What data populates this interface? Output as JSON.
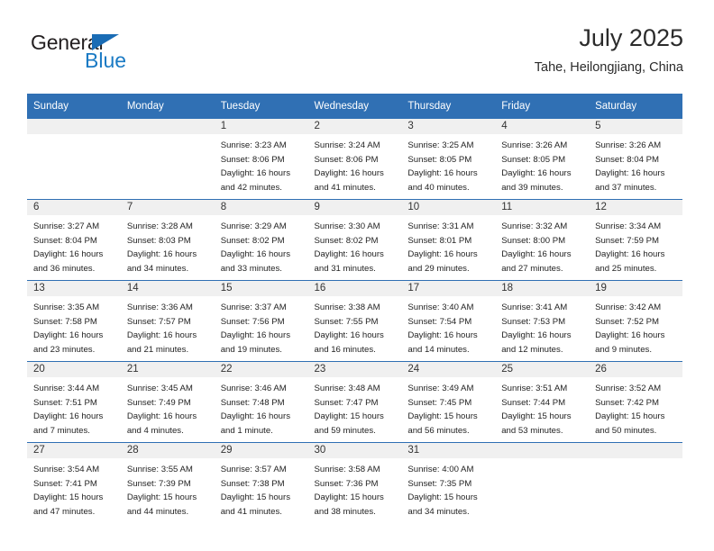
{
  "brand": {
    "name_dark": "General",
    "name_blue": "Blue",
    "triangle_color": "#1a6cb5",
    "blue_text_color": "#1a7ac4"
  },
  "header": {
    "title": "July 2025",
    "location": "Tahe, Heilongjiang, China"
  },
  "theme": {
    "header_blue": "#3070b4",
    "row_divider_blue": "#2f6fb3",
    "daynum_band": "#f0f0f0"
  },
  "weekday_headers": [
    "Sunday",
    "Monday",
    "Tuesday",
    "Wednesday",
    "Thursday",
    "Friday",
    "Saturday"
  ],
  "weeks": [
    [
      {
        "day": "",
        "sunrise": "",
        "sunset": "",
        "daylight_line1": "",
        "daylight_line2": ""
      },
      {
        "day": "",
        "sunrise": "",
        "sunset": "",
        "daylight_line1": "",
        "daylight_line2": ""
      },
      {
        "day": "1",
        "sunrise": "Sunrise: 3:23 AM",
        "sunset": "Sunset: 8:06 PM",
        "daylight_line1": "Daylight: 16 hours",
        "daylight_line2": "and 42 minutes."
      },
      {
        "day": "2",
        "sunrise": "Sunrise: 3:24 AM",
        "sunset": "Sunset: 8:06 PM",
        "daylight_line1": "Daylight: 16 hours",
        "daylight_line2": "and 41 minutes."
      },
      {
        "day": "3",
        "sunrise": "Sunrise: 3:25 AM",
        "sunset": "Sunset: 8:05 PM",
        "daylight_line1": "Daylight: 16 hours",
        "daylight_line2": "and 40 minutes."
      },
      {
        "day": "4",
        "sunrise": "Sunrise: 3:26 AM",
        "sunset": "Sunset: 8:05 PM",
        "daylight_line1": "Daylight: 16 hours",
        "daylight_line2": "and 39 minutes."
      },
      {
        "day": "5",
        "sunrise": "Sunrise: 3:26 AM",
        "sunset": "Sunset: 8:04 PM",
        "daylight_line1": "Daylight: 16 hours",
        "daylight_line2": "and 37 minutes."
      }
    ],
    [
      {
        "day": "6",
        "sunrise": "Sunrise: 3:27 AM",
        "sunset": "Sunset: 8:04 PM",
        "daylight_line1": "Daylight: 16 hours",
        "daylight_line2": "and 36 minutes."
      },
      {
        "day": "7",
        "sunrise": "Sunrise: 3:28 AM",
        "sunset": "Sunset: 8:03 PM",
        "daylight_line1": "Daylight: 16 hours",
        "daylight_line2": "and 34 minutes."
      },
      {
        "day": "8",
        "sunrise": "Sunrise: 3:29 AM",
        "sunset": "Sunset: 8:02 PM",
        "daylight_line1": "Daylight: 16 hours",
        "daylight_line2": "and 33 minutes."
      },
      {
        "day": "9",
        "sunrise": "Sunrise: 3:30 AM",
        "sunset": "Sunset: 8:02 PM",
        "daylight_line1": "Daylight: 16 hours",
        "daylight_line2": "and 31 minutes."
      },
      {
        "day": "10",
        "sunrise": "Sunrise: 3:31 AM",
        "sunset": "Sunset: 8:01 PM",
        "daylight_line1": "Daylight: 16 hours",
        "daylight_line2": "and 29 minutes."
      },
      {
        "day": "11",
        "sunrise": "Sunrise: 3:32 AM",
        "sunset": "Sunset: 8:00 PM",
        "daylight_line1": "Daylight: 16 hours",
        "daylight_line2": "and 27 minutes."
      },
      {
        "day": "12",
        "sunrise": "Sunrise: 3:34 AM",
        "sunset": "Sunset: 7:59 PM",
        "daylight_line1": "Daylight: 16 hours",
        "daylight_line2": "and 25 minutes."
      }
    ],
    [
      {
        "day": "13",
        "sunrise": "Sunrise: 3:35 AM",
        "sunset": "Sunset: 7:58 PM",
        "daylight_line1": "Daylight: 16 hours",
        "daylight_line2": "and 23 minutes."
      },
      {
        "day": "14",
        "sunrise": "Sunrise: 3:36 AM",
        "sunset": "Sunset: 7:57 PM",
        "daylight_line1": "Daylight: 16 hours",
        "daylight_line2": "and 21 minutes."
      },
      {
        "day": "15",
        "sunrise": "Sunrise: 3:37 AM",
        "sunset": "Sunset: 7:56 PM",
        "daylight_line1": "Daylight: 16 hours",
        "daylight_line2": "and 19 minutes."
      },
      {
        "day": "16",
        "sunrise": "Sunrise: 3:38 AM",
        "sunset": "Sunset: 7:55 PM",
        "daylight_line1": "Daylight: 16 hours",
        "daylight_line2": "and 16 minutes."
      },
      {
        "day": "17",
        "sunrise": "Sunrise: 3:40 AM",
        "sunset": "Sunset: 7:54 PM",
        "daylight_line1": "Daylight: 16 hours",
        "daylight_line2": "and 14 minutes."
      },
      {
        "day": "18",
        "sunrise": "Sunrise: 3:41 AM",
        "sunset": "Sunset: 7:53 PM",
        "daylight_line1": "Daylight: 16 hours",
        "daylight_line2": "and 12 minutes."
      },
      {
        "day": "19",
        "sunrise": "Sunrise: 3:42 AM",
        "sunset": "Sunset: 7:52 PM",
        "daylight_line1": "Daylight: 16 hours",
        "daylight_line2": "and 9 minutes."
      }
    ],
    [
      {
        "day": "20",
        "sunrise": "Sunrise: 3:44 AM",
        "sunset": "Sunset: 7:51 PM",
        "daylight_line1": "Daylight: 16 hours",
        "daylight_line2": "and 7 minutes."
      },
      {
        "day": "21",
        "sunrise": "Sunrise: 3:45 AM",
        "sunset": "Sunset: 7:49 PM",
        "daylight_line1": "Daylight: 16 hours",
        "daylight_line2": "and 4 minutes."
      },
      {
        "day": "22",
        "sunrise": "Sunrise: 3:46 AM",
        "sunset": "Sunset: 7:48 PM",
        "daylight_line1": "Daylight: 16 hours",
        "daylight_line2": "and 1 minute."
      },
      {
        "day": "23",
        "sunrise": "Sunrise: 3:48 AM",
        "sunset": "Sunset: 7:47 PM",
        "daylight_line1": "Daylight: 15 hours",
        "daylight_line2": "and 59 minutes."
      },
      {
        "day": "24",
        "sunrise": "Sunrise: 3:49 AM",
        "sunset": "Sunset: 7:45 PM",
        "daylight_line1": "Daylight: 15 hours",
        "daylight_line2": "and 56 minutes."
      },
      {
        "day": "25",
        "sunrise": "Sunrise: 3:51 AM",
        "sunset": "Sunset: 7:44 PM",
        "daylight_line1": "Daylight: 15 hours",
        "daylight_line2": "and 53 minutes."
      },
      {
        "day": "26",
        "sunrise": "Sunrise: 3:52 AM",
        "sunset": "Sunset: 7:42 PM",
        "daylight_line1": "Daylight: 15 hours",
        "daylight_line2": "and 50 minutes."
      }
    ],
    [
      {
        "day": "27",
        "sunrise": "Sunrise: 3:54 AM",
        "sunset": "Sunset: 7:41 PM",
        "daylight_line1": "Daylight: 15 hours",
        "daylight_line2": "and 47 minutes."
      },
      {
        "day": "28",
        "sunrise": "Sunrise: 3:55 AM",
        "sunset": "Sunset: 7:39 PM",
        "daylight_line1": "Daylight: 15 hours",
        "daylight_line2": "and 44 minutes."
      },
      {
        "day": "29",
        "sunrise": "Sunrise: 3:57 AM",
        "sunset": "Sunset: 7:38 PM",
        "daylight_line1": "Daylight: 15 hours",
        "daylight_line2": "and 41 minutes."
      },
      {
        "day": "30",
        "sunrise": "Sunrise: 3:58 AM",
        "sunset": "Sunset: 7:36 PM",
        "daylight_line1": "Daylight: 15 hours",
        "daylight_line2": "and 38 minutes."
      },
      {
        "day": "31",
        "sunrise": "Sunrise: 4:00 AM",
        "sunset": "Sunset: 7:35 PM",
        "daylight_line1": "Daylight: 15 hours",
        "daylight_line2": "and 34 minutes."
      },
      {
        "day": "",
        "sunrise": "",
        "sunset": "",
        "daylight_line1": "",
        "daylight_line2": ""
      },
      {
        "day": "",
        "sunrise": "",
        "sunset": "",
        "daylight_line1": "",
        "daylight_line2": ""
      }
    ]
  ]
}
